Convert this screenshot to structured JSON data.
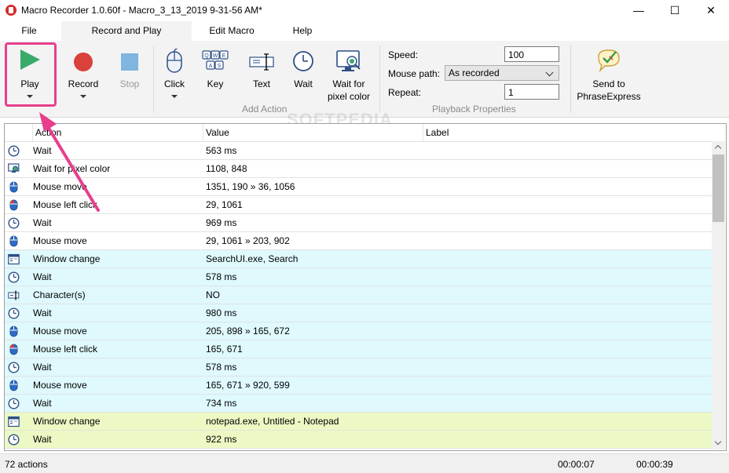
{
  "window": {
    "title": "Macro Recorder 1.0.60f - Macro_3_13_2019 9-31-56 AM*",
    "minimize": "—",
    "maximize": "☐",
    "close": "✕"
  },
  "menu": {
    "tabs": [
      {
        "label": "File"
      },
      {
        "label": "Record and Play"
      },
      {
        "label": "Edit Macro"
      },
      {
        "label": "Help"
      }
    ]
  },
  "ribbon": {
    "play": "Play",
    "record": "Record",
    "stop": "Stop",
    "click": "Click",
    "key": "Key",
    "text": "Text",
    "wait": "Wait",
    "wait_pixel_1": "Wait for",
    "wait_pixel_2": "pixel color",
    "add_action_group": "Add Action",
    "speed_label": "Speed:",
    "speed_value": "100",
    "mouse_path_label": "Mouse path:",
    "mouse_path_value": "As recorded",
    "repeat_label": "Repeat:",
    "repeat_value": "1",
    "playback_group": "Playback Properties",
    "send_1": "Send to",
    "send_2": "PhraseExpress"
  },
  "watermark": "SOFTPEDIA",
  "grid": {
    "headers": [
      "Action",
      "Value",
      "Label"
    ],
    "rows": [
      {
        "icon": "clock-icon",
        "action": "Wait",
        "value": "563 ms",
        "bg": "white"
      },
      {
        "icon": "pixel-color-icon",
        "action": "Wait for pixel color",
        "value": "1108, 848",
        "bg": "white"
      },
      {
        "icon": "mouse-icon",
        "action": "Mouse move",
        "value": "1351, 190 » 36, 1056",
        "bg": "white"
      },
      {
        "icon": "mouse-left-click-icon",
        "action": "Mouse left click",
        "value": "29, 1061",
        "bg": "white"
      },
      {
        "icon": "clock-icon",
        "action": "Wait",
        "value": "969 ms",
        "bg": "white"
      },
      {
        "icon": "mouse-icon",
        "action": "Mouse move",
        "value": "29, 1061 » 203, 902",
        "bg": "white"
      },
      {
        "icon": "window-icon",
        "action": "Window change",
        "value": "SearchUI.exe, Search",
        "bg": "cyan"
      },
      {
        "icon": "clock-icon",
        "action": "Wait",
        "value": "578 ms",
        "bg": "cyan"
      },
      {
        "icon": "text-cursor-icon",
        "action": "Character(s)",
        "value": "NO",
        "bg": "cyan"
      },
      {
        "icon": "clock-icon",
        "action": "Wait",
        "value": "980 ms",
        "bg": "cyan"
      },
      {
        "icon": "mouse-icon",
        "action": "Mouse move",
        "value": "205, 898 » 165, 672",
        "bg": "cyan"
      },
      {
        "icon": "mouse-left-click-icon",
        "action": "Mouse left click",
        "value": "165, 671",
        "bg": "cyan"
      },
      {
        "icon": "clock-icon",
        "action": "Wait",
        "value": "578 ms",
        "bg": "cyan"
      },
      {
        "icon": "mouse-icon",
        "action": "Mouse move",
        "value": "165, 671 » 920, 599",
        "bg": "cyan"
      },
      {
        "icon": "clock-icon",
        "action": "Wait",
        "value": "734 ms",
        "bg": "cyan"
      },
      {
        "icon": "window-icon",
        "action": "Window change",
        "value": "notepad.exe, Untitled - Notepad",
        "bg": "lime"
      },
      {
        "icon": "clock-icon",
        "action": "Wait",
        "value": "922 ms",
        "bg": "lime"
      }
    ]
  },
  "status": {
    "actions": "72 actions",
    "time1": "00:00:07",
    "time2": "00:00:39"
  },
  "colors": {
    "play": "#3aaa6b",
    "record": "#d9413a",
    "stop": "#7fb5de",
    "highlight": "#e83e8c"
  }
}
